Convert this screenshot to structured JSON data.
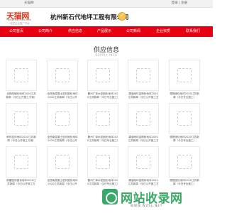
{
  "topbar": {
    "site_name": "天猫网",
    "auth": "登录 | 注册"
  },
  "header": {
    "logo_brand": "天猫网",
    "logo_url": "www.tianmao.com",
    "logo_slogan": "一站式企业推广平台",
    "company": "杭州新石代地坪工程有限公司"
  },
  "nav": [
    "公司首页",
    "公司简介",
    "供应信息",
    "产品展示",
    "公司新闻",
    "企业资质",
    "联系我们"
  ],
  "section": {
    "title": "供应信息",
    "subtitle": "SUPPLY INFO"
  },
  "products": [
    {
      "caption": "全西南固化地坪2020江苏新闻（今日公开施工方案）"
    },
    {
      "caption": "全西南混凝土密封固化地坪2020江苏新闻（今日公开施工方案）"
    },
    {
      "caption": "衢州广泽水密固化地坪2020江苏新闻（今日专业施工）"
    },
    {
      "caption": "康涵地坪金刚砂地坪2020江苏新闻（今日公开施工方案）"
    },
    {
      "caption": "德阳固化地坪2020江苏新闻（今日专业施工）"
    },
    {
      "caption": "耐热密封地坪2020江苏新闻（今日公开施工方案）"
    },
    {
      "caption": "全西南混凝土密封固化地坪2020江苏新闻（今日公开施工方案）"
    },
    {
      "caption": "衢州广泽水密固化地坪2020江苏新闻（今日专业施工）"
    },
    {
      "caption": "康涵地坪金刚砂地坪2020江苏新闻（今日公开施工方案）"
    },
    {
      "caption": "德阳固化地坪2020江苏新闻（今日专业施工）"
    },
    {
      "caption": "耐磨密封固化地坪2020江苏新闻（今日公开施工方案）"
    },
    {
      "caption": "全西南混凝土密封固化地坪2020江苏新闻（今日公开施工方案）"
    },
    {
      "caption": "衢州广泽水密固化地坪2020江苏新闻（今日专业施工）"
    },
    {
      "caption": "康涵地坪金刚砂地坪2020江苏新闻（今日公开施工方案）"
    },
    {
      "caption": "德阳固化地坪2020江苏新闻（今日专业施工）"
    }
  ],
  "watermark": {
    "text": "网站收录网",
    "url": "WWW.WZSL.NET"
  },
  "colors": {
    "nav_bg": "#e60012",
    "brand": "#e8371b",
    "watermark": "#3aa865"
  }
}
